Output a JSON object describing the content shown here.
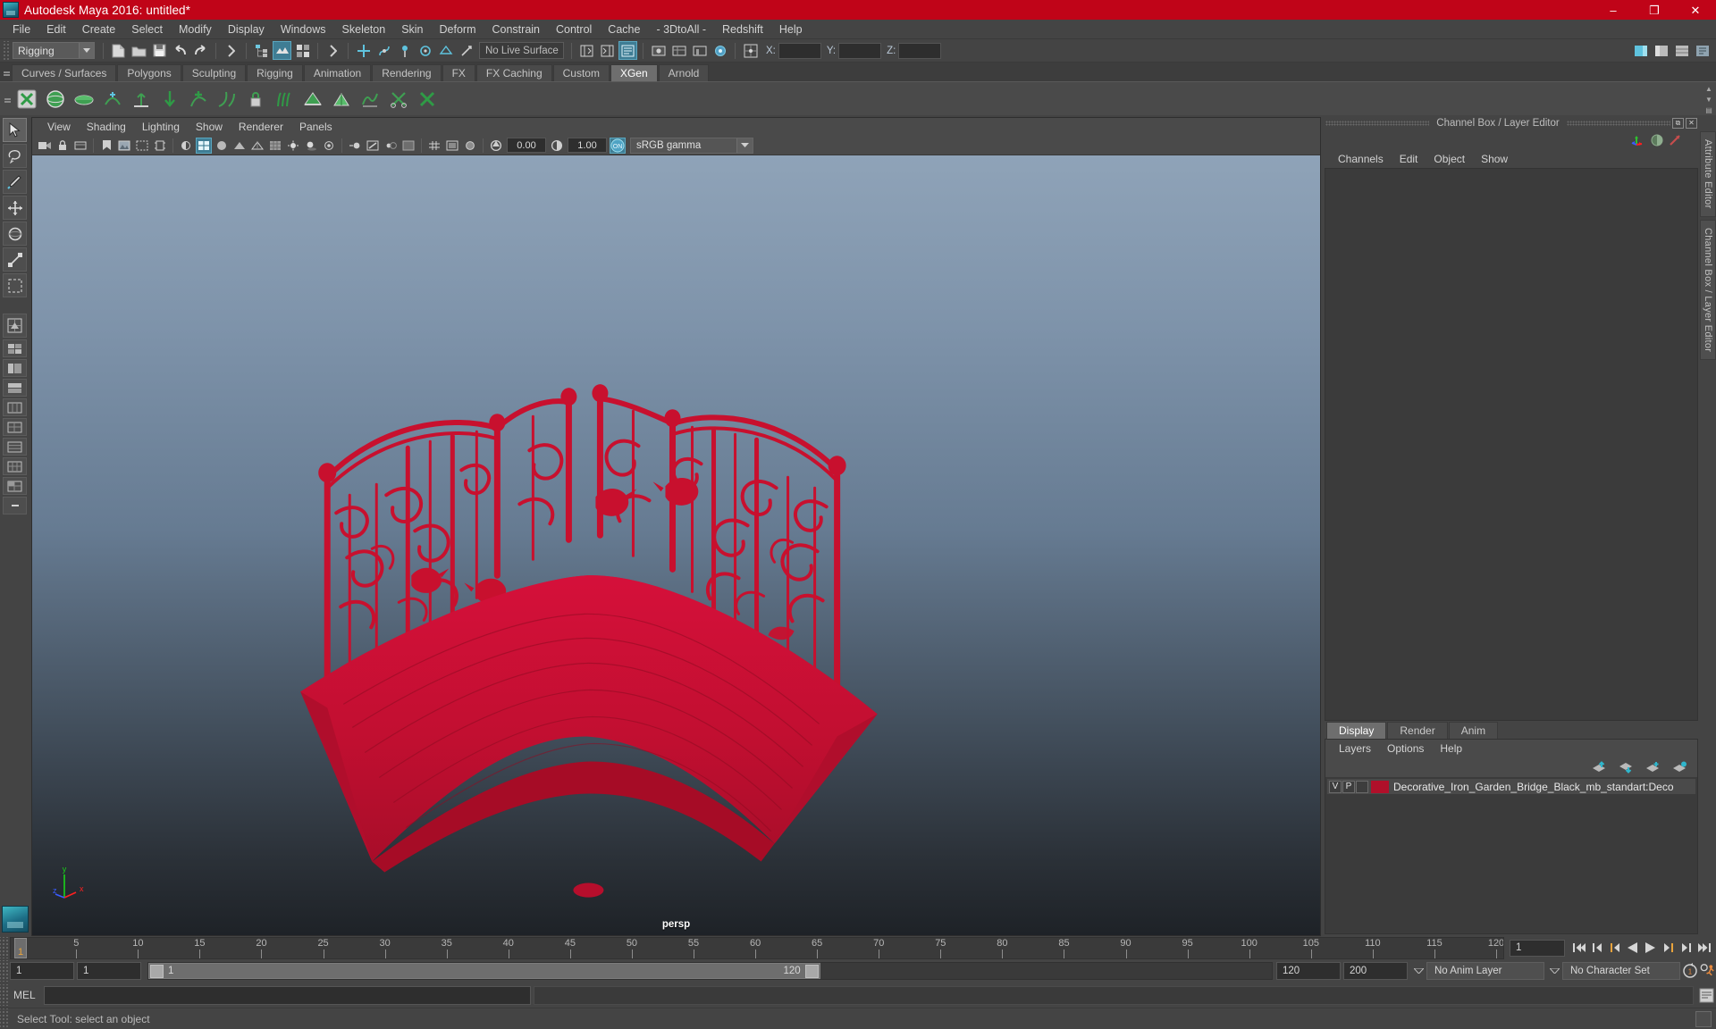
{
  "window": {
    "title": "Autodesk Maya 2016: untitled*",
    "logo_icon": "maya-logo-icon",
    "minimize_label": "–",
    "maximize_label": "❐",
    "close_label": "✕",
    "title_bar_color": "#c00418"
  },
  "menubar": {
    "items": [
      {
        "label": "File"
      },
      {
        "label": "Edit"
      },
      {
        "label": "Create"
      },
      {
        "label": "Select"
      },
      {
        "label": "Modify"
      },
      {
        "label": "Display"
      },
      {
        "label": "Windows"
      },
      {
        "label": "Skeleton"
      },
      {
        "label": "Skin"
      },
      {
        "label": "Deform"
      },
      {
        "label": "Constrain"
      },
      {
        "label": "Control"
      },
      {
        "label": "Cache"
      },
      {
        "label": "- 3DtoAll -"
      },
      {
        "label": "Redshift"
      },
      {
        "label": "Help"
      }
    ]
  },
  "statusline": {
    "menu_set": "Rigging",
    "live_surface": "No Live Surface",
    "coord_x_label": "X:",
    "coord_y_label": "Y:",
    "coord_z_label": "Z:",
    "coord_x_value": "",
    "coord_y_value": "",
    "coord_z_value": "",
    "icons": [
      "new-scene-icon",
      "open-scene-icon",
      "save-scene-icon",
      "undo-icon",
      "redo-icon",
      "select-by-hierarchy-icon",
      "select-by-object-icon",
      "select-by-component-icon",
      "snap-to-grid-icon",
      "snap-to-curve-icon",
      "snap-to-point-icon",
      "snap-to-projected-center-icon",
      "snap-to-view-plane-icon",
      "make-live-icon",
      "show-hide-editors-icon",
      "attribute-editor-toggle-icon",
      "tool-settings-toggle-icon",
      "channel-box-toggle-icon",
      "numeric-input-icon"
    ]
  },
  "shelf": {
    "tabs": [
      {
        "label": "Curves / Surfaces",
        "active": false
      },
      {
        "label": "Polygons",
        "active": false
      },
      {
        "label": "Sculpting",
        "active": false
      },
      {
        "label": "Rigging",
        "active": false
      },
      {
        "label": "Animation",
        "active": false
      },
      {
        "label": "Rendering",
        "active": false
      },
      {
        "label": "FX",
        "active": false
      },
      {
        "label": "FX Caching",
        "active": false
      },
      {
        "label": "Custom",
        "active": false
      },
      {
        "label": "XGen",
        "active": true
      },
      {
        "label": "Arnold",
        "active": false
      }
    ],
    "buttons": [
      "xgen-editor-icon",
      "xgen-sphere-icon",
      "xgen-disc-icon",
      "xgen-cross-section-icon",
      "xgen-axis-icon",
      "xgen-groom-down-icon",
      "xgen-add-guide-icon",
      "xgen-curve-icon",
      "xgen-lock-icon",
      "xgen-comb-icon",
      "xgen-density-icon",
      "xgen-clump-icon",
      "xgen-noise-icon",
      "xgen-cut-icon",
      "xgen-delete-icon"
    ]
  },
  "toolbox": {
    "tools": [
      {
        "name": "select-tool",
        "selected": true
      },
      {
        "name": "lasso-select-tool",
        "selected": false
      },
      {
        "name": "paint-select-tool",
        "selected": false
      },
      {
        "name": "move-tool",
        "selected": false
      },
      {
        "name": "rotate-tool",
        "selected": false
      },
      {
        "name": "scale-tool",
        "selected": false
      },
      {
        "name": "last-tool-used",
        "selected": false
      }
    ],
    "layout_buttons": [
      "single-perspective-layout-icon",
      "four-view-layout-icon",
      "persp-outliner-layout-icon",
      "persp-graph-layout-icon",
      "hypershade-persp-layout-icon",
      "persp-graph-outliner-layout-icon",
      "two-pane-stacked-layout-icon",
      "three-pane-split-layout-icon",
      "four-pane-layout-icon",
      "minimize-layout-icon"
    ]
  },
  "viewport": {
    "menus": [
      {
        "label": "View"
      },
      {
        "label": "Shading"
      },
      {
        "label": "Lighting"
      },
      {
        "label": "Show"
      },
      {
        "label": "Renderer"
      },
      {
        "label": "Panels"
      }
    ],
    "exposure_value": "0.00",
    "gamma_value": "1.00",
    "color_management": "sRGB gamma",
    "camera_label": "persp",
    "axis_x_label": "x",
    "axis_y_label": "y",
    "axis_z_label": "z",
    "model_name": "Decorative Iron Garden Bridge",
    "model_color": "#c8102e",
    "background_top": "#8fa3b8",
    "background_bottom": "#1e2227",
    "toolbar_icons": [
      "select-camera-icon",
      "lock-camera-icon",
      "camera-attributes-icon",
      "bookmark-icon",
      "image-plane-icon",
      "two-sided-lighting-icon",
      "shadows-icon",
      "wireframe-icon",
      "smooth-shade-all-icon",
      "smooth-shade-selected-icon",
      "flat-shade-icon",
      "wireframe-on-shaded-icon",
      "xray-icon",
      "xray-joints-icon",
      "xray-active-components-icon",
      "default-lighting-icon",
      "scene-lights-icon",
      "light-toggle-icon",
      "shadow-toggle-icon",
      "screen-space-ao-icon",
      "motion-blur-icon",
      "multisample-icon",
      "depth-of-field-icon",
      "isolate-select-icon",
      "grid-toggle-icon",
      "film-gate-icon",
      "resolution-gate-icon",
      "gate-mask-icon",
      "exposure-icon",
      "gamma-icon",
      "color-management-toggle-icon"
    ]
  },
  "channelbox": {
    "panel_title": "Channel Box / Layer Editor",
    "undock_label": "⧉",
    "close_label": "✕",
    "menus": [
      {
        "label": "Channels"
      },
      {
        "label": "Edit"
      },
      {
        "label": "Object"
      },
      {
        "label": "Show"
      }
    ],
    "toolbar_icons": [
      "transform-channels-icon",
      "output-channels-icon",
      "shape-channels-icon"
    ]
  },
  "layer_editor": {
    "tabs": [
      {
        "label": "Display",
        "active": true
      },
      {
        "label": "Render",
        "active": false
      },
      {
        "label": "Anim",
        "active": false
      }
    ],
    "menus": [
      {
        "label": "Layers"
      },
      {
        "label": "Options"
      },
      {
        "label": "Help"
      }
    ],
    "buttons": [
      "move-layer-up-icon",
      "move-layer-down-icon",
      "new-layer-icon",
      "new-layer-from-selected-icon"
    ],
    "layers": [
      {
        "visibility_flag": "V",
        "playback_flag": "P",
        "state_flag": "",
        "color": "#b0102a",
        "name": "Decorative_Iron_Garden_Bridge_Black_mb_standart:Deco"
      }
    ]
  },
  "side_tabs": [
    {
      "label": "Attribute Editor"
    },
    {
      "label": "Channel Box / Layer Editor"
    }
  ],
  "timeline": {
    "start": 1,
    "end": 120,
    "current_frame": "1",
    "tick_step": 5,
    "labels": [
      5,
      10,
      15,
      20,
      25,
      30,
      35,
      40,
      45,
      50,
      55,
      60,
      65,
      70,
      75,
      80,
      85,
      90,
      95,
      100,
      105,
      110,
      115,
      120
    ],
    "playback_buttons": [
      "go-to-start-icon",
      "step-back-keyframe-icon",
      "step-back-frame-icon",
      "play-backwards-icon",
      "play-forwards-icon",
      "step-forward-frame-icon",
      "step-forward-keyframe-icon",
      "go-to-end-icon"
    ]
  },
  "range_slider": {
    "anim_start": "1",
    "playback_start": "1",
    "bar_start_label": "1",
    "bar_end_label": "120",
    "playback_end": "120",
    "anim_end": "200",
    "anim_layer": "No Anim Layer",
    "character_set": "No Character Set",
    "auto_key_icon": "auto-keyframe-icon",
    "anim_prefs_icon": "animation-preferences-icon"
  },
  "command_line": {
    "language_label": "MEL",
    "input_value": "",
    "output_value": "",
    "script_editor_icon": "script-editor-icon"
  },
  "status_bar": {
    "message": "Select Tool: select an object",
    "help_icon": "help-box-icon"
  }
}
